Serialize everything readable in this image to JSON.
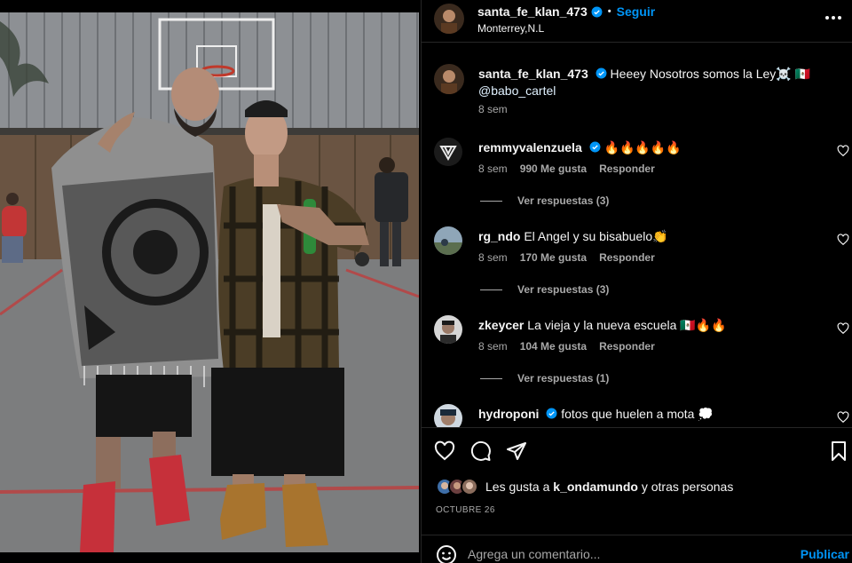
{
  "post": {
    "author": "santa_fe_klan_473",
    "follow_label": "Seguir",
    "separator": "•",
    "location": "Monterrey,N.L",
    "caption_user": "santa_fe_klan_473",
    "caption_text": "Heeey Nosotros somos la Ley☠️ 🇲🇽",
    "caption_mention": "@babo_cartel",
    "caption_time": "8 sem"
  },
  "comments": [
    {
      "user": "remmyvalenzuela",
      "verified": true,
      "text": "🔥🔥🔥🔥🔥",
      "time": "8 sem",
      "likes": "990 Me gusta",
      "reply": "Responder",
      "view_replies": "Ver respuestas (3)"
    },
    {
      "user": "rg_ndo",
      "verified": false,
      "text": "El Angel y su bisabuelo👏",
      "time": "8 sem",
      "likes": "170 Me gusta",
      "reply": "Responder",
      "view_replies": "Ver respuestas (3)"
    },
    {
      "user": "zkeycer",
      "verified": false,
      "text": "La vieja y la nueva escuela 🇲🇽🔥🔥",
      "time": "8 sem",
      "likes": "104 Me gusta",
      "reply": "Responder",
      "view_replies": "Ver respuestas (1)"
    },
    {
      "user": "hydroponi",
      "verified": true,
      "text": "fotos que huelen a mota 💭",
      "time": "",
      "likes": "",
      "reply": "",
      "view_replies": ""
    }
  ],
  "likes_bar": {
    "prefix": "Les gusta a ",
    "user": "k_ondamundo",
    "suffix": " y otras personas"
  },
  "date": "OCTUBRE 26",
  "add_comment": {
    "placeholder": "Agrega un comentario...",
    "publish_label": "Publicar"
  },
  "icons": {
    "header": [
      "verified-badge-icon",
      "more-options-icon"
    ],
    "actions": [
      "like-heart-icon",
      "comment-icon",
      "share-icon",
      "save-bookmark-icon"
    ],
    "emoji": "emoji-icon"
  },
  "colors": {
    "background": "#000000",
    "text": "#f5f5f5",
    "secondary": "#a8a8a8",
    "accent": "#0095f6",
    "divider": "#262626"
  }
}
